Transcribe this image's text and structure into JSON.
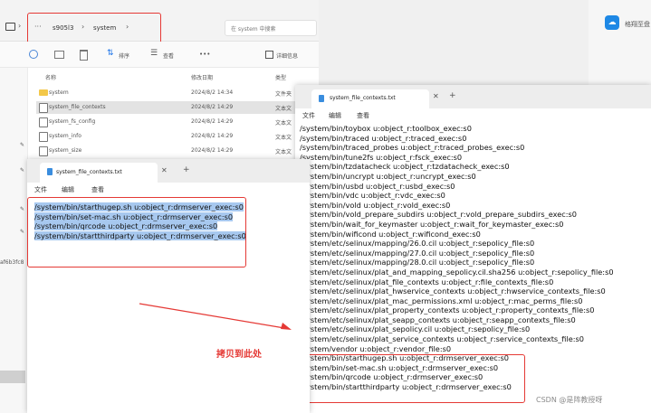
{
  "explorer": {
    "breadcrumb": [
      "s905l3",
      "system"
    ],
    "search_placeholder": "在 system 中搜索",
    "toolbar": {
      "sort_label": "排序",
      "view_label": "查看",
      "more_label": "•••",
      "details_label": "详细信息"
    },
    "columns": {
      "name": "名称",
      "date": "修改日期",
      "type": "类型"
    },
    "rows": [
      {
        "name": "system",
        "date": "2024/8/2 14:34",
        "type": "文件夹",
        "icon": "folder"
      },
      {
        "name": "system_file_contexts",
        "date": "2024/8/2 14:29",
        "type": "文本文",
        "icon": "file"
      },
      {
        "name": "system_fs_config",
        "date": "2024/8/2 14:29",
        "type": "文本文",
        "icon": "file"
      },
      {
        "name": "system_info",
        "date": "2024/8/2 14:29",
        "type": "文本文",
        "icon": "file"
      },
      {
        "name": "system_size",
        "date": "2024/8/2 14:29",
        "type": "文本文",
        "icon": "file"
      }
    ],
    "side_fragment": "af6b3fc8"
  },
  "right_strip": {
    "label": "格翔至盘"
  },
  "notepad_left": {
    "tab_title": "system_file_contexts.txt",
    "menu": [
      "文件",
      "编辑",
      "查看"
    ],
    "lines": [
      "/system/bin/starthugep.sh u:object_r:drmserver_exec:s0",
      "/system/bin/set-mac.sh u:object_r:drmserver_exec:s0",
      "/system/bin/qrcode u:object_r:drmserver_exec:s0",
      "/system/bin/startthirdparty u:object_r:drmserver_exec:s0"
    ]
  },
  "notepad_right": {
    "tab_title": "system_file_contexts.txt",
    "menu": [
      "文件",
      "编辑",
      "查看"
    ],
    "lines": [
      "/system/bin/toybox u:object_r:toolbox_exec:s0",
      "/system/bin/traced u:object_r:traced_exec:s0",
      "/system/bin/traced_probes u:object_r:traced_probes_exec:s0",
      "/system/bin/tune2fs u:object_r:fsck_exec:s0",
      "/system/bin/tzdatacheck u:object_r:tzdatacheck_exec:s0",
      "/system/bin/uncrypt u:object_r:uncrypt_exec:s0",
      "/system/bin/usbd u:object_r:usbd_exec:s0",
      "/system/bin/vdc u:object_r:vdc_exec:s0",
      "/system/bin/vold u:object_r:vold_exec:s0",
      "/system/bin/vold_prepare_subdirs u:object_r:vold_prepare_subdirs_exec:s0",
      "/system/bin/wait_for_keymaster u:object_r:wait_for_keymaster_exec:s0",
      "/system/bin/wificond u:object_r:wificond_exec:s0",
      "/system/etc/selinux/mapping/26.0.cil u:object_r:sepolicy_file:s0",
      "/system/etc/selinux/mapping/27.0.cil u:object_r:sepolicy_file:s0",
      "/system/etc/selinux/mapping/28.0.cil u:object_r:sepolicy_file:s0",
      "/system/etc/selinux/plat_and_mapping_sepolicy.cil.sha256 u:object_r:sepolicy_file:s0",
      "/system/etc/selinux/plat_file_contexts u:object_r:file_contexts_file:s0",
      "/system/etc/selinux/plat_hwservice_contexts u:object_r:hwservice_contexts_file:s0",
      "/system/etc/selinux/plat_mac_permissions.xml u:object_r:mac_perms_file:s0",
      "/system/etc/selinux/plat_property_contexts u:object_r:property_contexts_file:s0",
      "/system/etc/selinux/plat_seapp_contexts u:object_r:seapp_contexts_file:s0",
      "/system/etc/selinux/plat_sepolicy.cil u:object_r:sepolicy_file:s0",
      "/system/etc/selinux/plat_service_contexts u:object_r:service_contexts_file:s0",
      "/system/vendor u:object_r:vendor_file:s0",
      "/system/bin/starthugep.sh u:object_r:drmserver_exec:s0",
      "/system/bin/set-mac.sh u:object_r:drmserver_exec:s0",
      "/system/bin/qrcode u:object_r:drmserver_exec:s0",
      "/system/bin/startthirdparty u:object_r:drmserver_exec:s0"
    ]
  },
  "annotation": {
    "text": "拷贝到此处"
  },
  "watermark": "CSDN @是阵教授呀",
  "colors": {
    "annotation_red": "#e53935",
    "selection": "#a7c8ef",
    "folder": "#f3c84a"
  }
}
